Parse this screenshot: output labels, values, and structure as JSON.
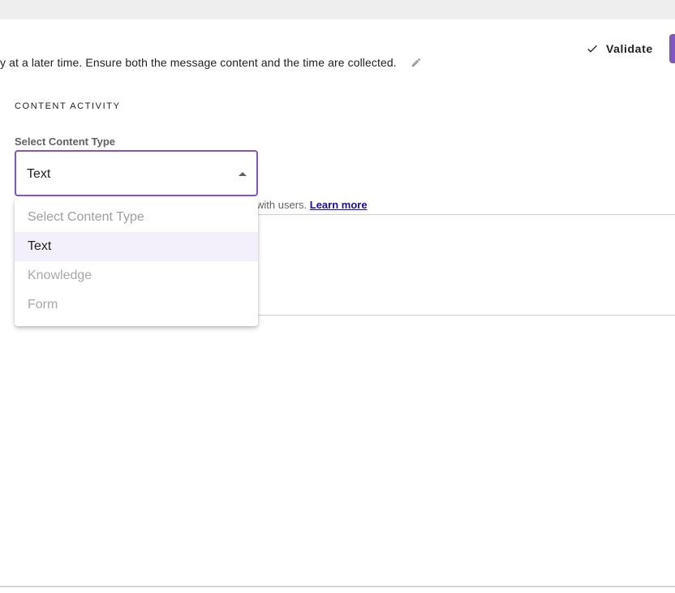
{
  "header": {
    "description": "y at a later time. Ensure both the message content and the time are collected.",
    "edit_icon": "pencil-icon",
    "validate_label": "Validate",
    "validate_icon": "check-icon",
    "accent_color": "#7e57c2"
  },
  "section": {
    "title": "CONTENT ACTIVITY"
  },
  "content_type": {
    "label": "Select Content Type",
    "value": "Text",
    "helper_text": "with users.",
    "helper_link": "Learn more"
  },
  "dropdown": {
    "options": [
      {
        "label": "Select Content Type",
        "state": "placeholder"
      },
      {
        "label": "Text",
        "state": "selected"
      },
      {
        "label": "Knowledge",
        "state": "disabled"
      },
      {
        "label": "Form",
        "state": "disabled"
      }
    ]
  }
}
